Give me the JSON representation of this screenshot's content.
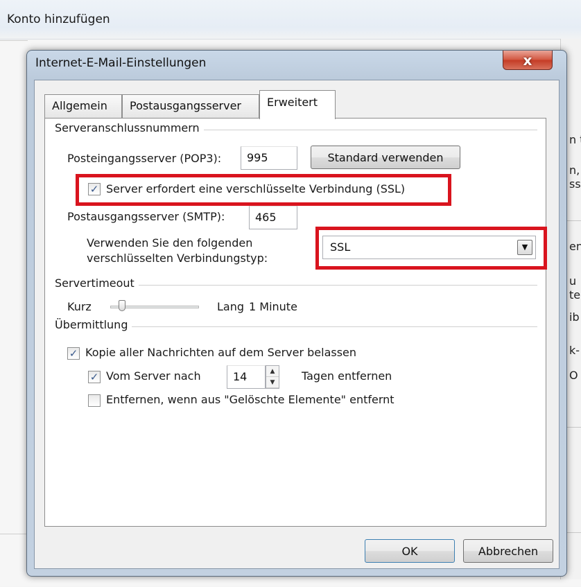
{
  "outer": {
    "title": "Konto hinzufügen",
    "right_fragments": [
      "n t",
      "n,",
      "ss",
      "en",
      "u",
      "te",
      "ib",
      "k-",
      "O"
    ]
  },
  "dialog": {
    "title": "Internet-E-Mail-Einstellungen",
    "close_label": "x"
  },
  "tabs": [
    {
      "label": "Allgemein"
    },
    {
      "label": "Postausgangsserver"
    },
    {
      "label": "Erweitert",
      "active": true
    }
  ],
  "server_ports": {
    "group_title": "Serveranschlussnummern",
    "pop3_label": "Posteingangsserver (POP3):",
    "pop3_value": "995",
    "default_button": "Standard verwenden",
    "ssl_checkbox_label": "Server erfordert eine verschlüsselte Verbindung (SSL)",
    "ssl_checked": true,
    "smtp_label": "Postausgangsserver (SMTP):",
    "smtp_value": "465",
    "encryption_label_line1": "Verwenden Sie den folgenden",
    "encryption_label_line2": "verschlüsselten Verbindungstyp:",
    "encryption_value": "SSL"
  },
  "timeout": {
    "group_title": "Servertimeout",
    "short_label": "Kurz",
    "long_label": "Lang",
    "value_text": "1 Minute",
    "slider_level": 0.1
  },
  "delivery": {
    "group_title": "Übermittlung",
    "keep_copy_label": "Kopie aller Nachrichten auf dem Server belassen",
    "keep_copy_checked": true,
    "remove_after_label": "Vom Server nach",
    "remove_after_checked": true,
    "days_value": "14",
    "days_suffix": "Tagen entfernen",
    "remove_deleted_label": "Entfernen, wenn aus \"Gelöschte Elemente\" entfernt",
    "remove_deleted_checked": false
  },
  "buttons": {
    "ok": "OK",
    "cancel": "Abbrechen"
  },
  "colors": {
    "highlight": "#d9141e",
    "close_button": "#c43b25"
  }
}
